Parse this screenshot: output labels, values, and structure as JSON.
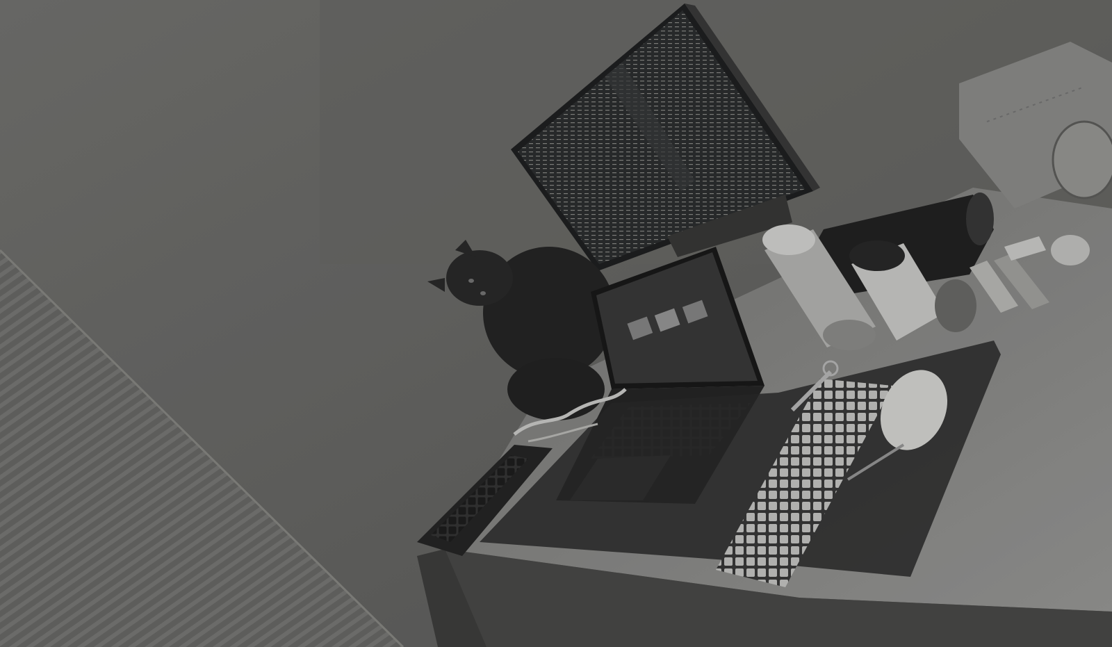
{
  "photo": {
    "tone": "grayscale-darkened"
  },
  "colors": {
    "wall": "#6f6f6c",
    "wall_dark": "#5a5a58",
    "desk": "#8a8a88",
    "mat": "#2e2e2e",
    "screen": "#2d2f30",
    "cat": "#2a2a2a"
  }
}
